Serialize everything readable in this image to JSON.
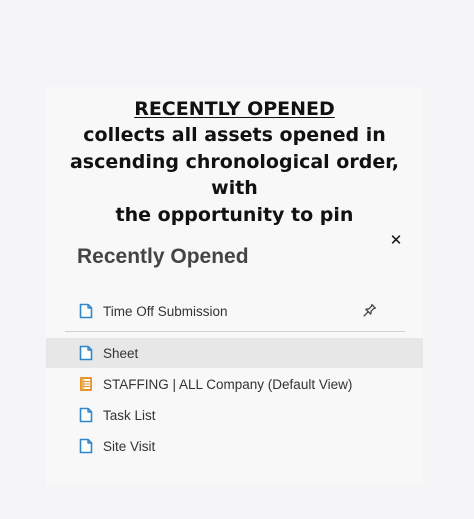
{
  "heading": {
    "title": "RECENTLY OPENED",
    "desc_line1": "collects all assets opened in",
    "desc_line2": "ascending chronological order, with",
    "desc_line3": "the opportunity to pin"
  },
  "panel": {
    "title": "Recently Opened",
    "close_glyph": "✕"
  },
  "pinned": [
    {
      "label": "Time Off Submission",
      "icon": "sheet-icon"
    }
  ],
  "recent": [
    {
      "label": "Sheet",
      "icon": "sheet-icon",
      "highlighted": true
    },
    {
      "label": "STAFFING | ALL Company (Default View)",
      "icon": "report-icon"
    },
    {
      "label": "Task List",
      "icon": "sheet-icon"
    },
    {
      "label": "Site Visit",
      "icon": "sheet-icon"
    }
  ],
  "colors": {
    "sheet_icon": "#2f86c9",
    "report_icon": "#e8942a",
    "highlight_row": "#e7e7e7"
  }
}
